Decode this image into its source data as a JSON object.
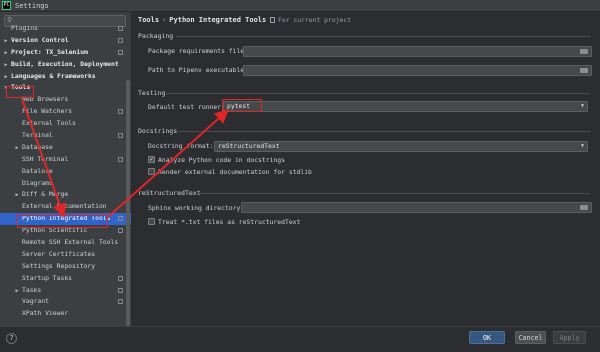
{
  "window": {
    "title": "Settings",
    "logo_text": "PC"
  },
  "sidebar": {
    "search_icon": "search-icon",
    "items": [
      {
        "label": "Plugins",
        "expandable": false,
        "bold": false,
        "config": true
      },
      {
        "label": "Version Control",
        "expandable": true,
        "bold": true,
        "config": true
      },
      {
        "label": "Project: TX_Selenium",
        "expandable": true,
        "bold": true,
        "config": true
      },
      {
        "label": "Build, Execution, Deployment",
        "expandable": true,
        "bold": true,
        "config": false
      },
      {
        "label": "Languages & Frameworks",
        "expandable": true,
        "bold": true,
        "config": false
      },
      {
        "label": "Tools",
        "expandable": true,
        "expanded": true,
        "bold": true,
        "config": false
      },
      {
        "label": "Web Browsers",
        "indent": true,
        "config": false
      },
      {
        "label": "File Watchers",
        "indent": true,
        "config": true
      },
      {
        "label": "External Tools",
        "indent": true,
        "config": false
      },
      {
        "label": "Terminal",
        "indent": true,
        "config": true
      },
      {
        "label": "Database",
        "indent": true,
        "expandable": true,
        "config": false
      },
      {
        "label": "SSH Terminal",
        "indent": true,
        "config": true
      },
      {
        "label": "Datalore",
        "indent": true,
        "config": false
      },
      {
        "label": "Diagrams",
        "indent": true,
        "config": false
      },
      {
        "label": "Diff & Merge",
        "indent": true,
        "expandable": true,
        "config": false
      },
      {
        "label": "External Documentation",
        "indent": true,
        "config": false
      },
      {
        "label": "Python Integrated Tools",
        "indent": true,
        "config": true,
        "selected": true
      },
      {
        "label": "Python Scientific",
        "indent": true,
        "config": true
      },
      {
        "label": "Remote SSH External Tools",
        "indent": true,
        "config": false
      },
      {
        "label": "Server Certificates",
        "indent": true,
        "config": false
      },
      {
        "label": "Settings Repository",
        "indent": true,
        "config": false
      },
      {
        "label": "Startup Tasks",
        "indent": true,
        "config": true
      },
      {
        "label": "Tasks",
        "indent": true,
        "expandable": true,
        "config": true
      },
      {
        "label": "Vagrant",
        "indent": true,
        "config": true
      },
      {
        "label": "XPath Viewer",
        "indent": true,
        "config": false
      }
    ]
  },
  "main": {
    "breadcrumb": {
      "parent": "Tools",
      "separator": "›",
      "current": "Python Integrated Tools"
    },
    "scope_label": "For current project",
    "packaging": {
      "heading": "Packaging",
      "requirements_label": "Package requirements file:",
      "requirements_value": "",
      "pipenv_label": "Path to Pipenv executable:",
      "pipenv_value": ""
    },
    "testing": {
      "heading": "Testing",
      "runner_label": "Default test runner:",
      "runner_value": "pytest"
    },
    "docstrings": {
      "heading": "Docstrings",
      "format_label": "Docstring format:",
      "format_value": "reStructuredText",
      "analyze_label": "Analyze Python code in docstrings",
      "analyze_checked": true,
      "render_label": "Render external documentation for stdlib",
      "render_checked": false
    },
    "rst": {
      "heading": "reStructuredText",
      "sphinx_label": "Sphinx working directory:",
      "sphinx_value": "",
      "treat_label": "Treat *.txt files as reStructuredText",
      "treat_checked": false
    }
  },
  "footer": {
    "help": "?",
    "ok": "OK",
    "cancel": "Cancel",
    "apply": "Apply"
  },
  "colors": {
    "accent": "#2f65ca",
    "annotation": "#e02626",
    "ok_button": "#365880"
  }
}
